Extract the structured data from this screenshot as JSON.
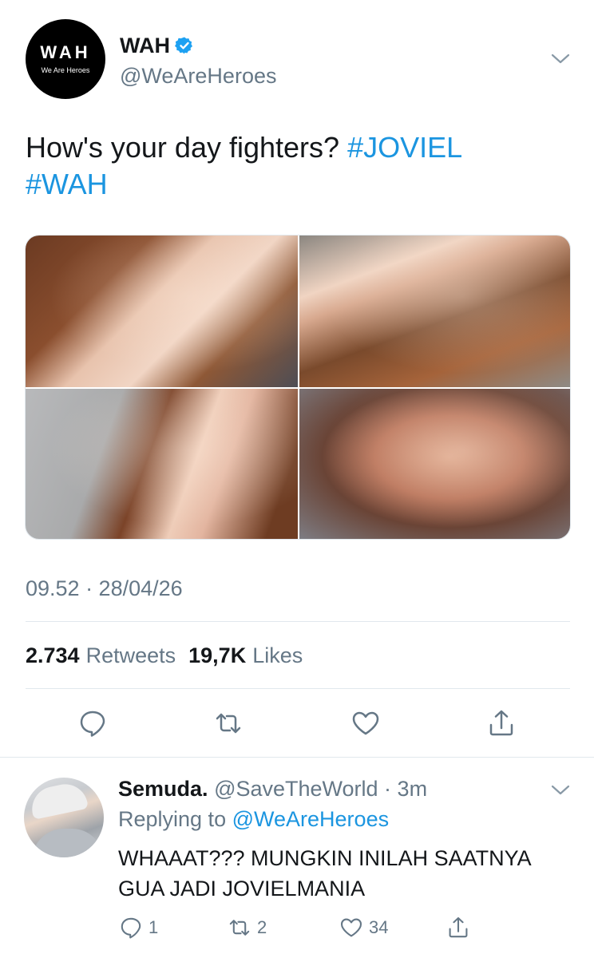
{
  "tweet": {
    "avatar": {
      "logo_text": "WAH",
      "logo_subtext": "We Are Heroes"
    },
    "display_name": "WAH",
    "handle": "@WeAreHeroes",
    "text_plain": "How's your day fighters? ",
    "hashtags": [
      "#JOVIEL",
      "#WAH"
    ],
    "timestamp": "09.52 · 28/04/26",
    "retweets_count": "2.734",
    "retweets_label": "Retweets",
    "likes_count": "19,7K",
    "likes_label": "Likes",
    "icons": {
      "verified": "verified-badge-icon",
      "menu": "chevron-down-icon",
      "reply": "reply-icon",
      "retweet": "retweet-icon",
      "like": "heart-icon",
      "share": "share-icon"
    }
  },
  "reply": {
    "display_name": "Semuda.",
    "handle_time": "@SaveTheWorld · 3m",
    "replying_prefix": "Replying to",
    "replying_to": "@WeAreHeroes",
    "text": "WHAAAT??? MUNGKIN INILAH SAATNYA GUA JADI JOVIELMANIA",
    "reply_count": "1",
    "retweet_count": "2",
    "like_count": "34"
  },
  "colors": {
    "accent": "#1b95e0",
    "verified": "#1da1f2",
    "secondary_text": "#657786",
    "primary_text": "#14171a",
    "divider": "#e1e8ed"
  }
}
